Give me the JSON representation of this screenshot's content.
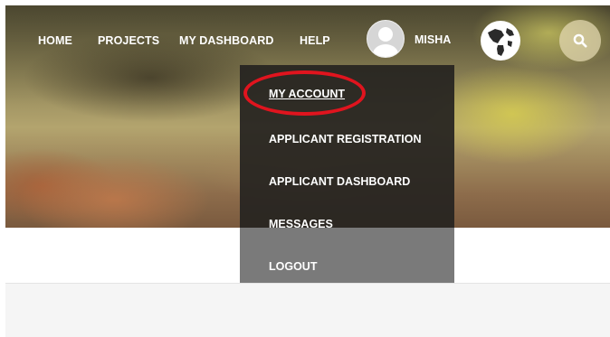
{
  "nav": {
    "home": "HOME",
    "projects": "PROJECTS",
    "my_dashboard": "MY DASHBOARD",
    "help": "HELP"
  },
  "user": {
    "name": "MISHA",
    "avatar_icon": "user-avatar-icon"
  },
  "icons": {
    "language": "globe-icon",
    "search": "search-icon"
  },
  "dropdown": {
    "items": [
      {
        "label": "MY ACCOUNT",
        "highlighted": true
      },
      {
        "label": "APPLICANT REGISTRATION"
      },
      {
        "label": "APPLICANT DASHBOARD"
      },
      {
        "label": "MESSAGES"
      },
      {
        "label": "LOGOUT"
      }
    ]
  },
  "colors": {
    "highlight_ring": "#e0141e",
    "menu_background": "#262420",
    "text": "#ffffff"
  }
}
